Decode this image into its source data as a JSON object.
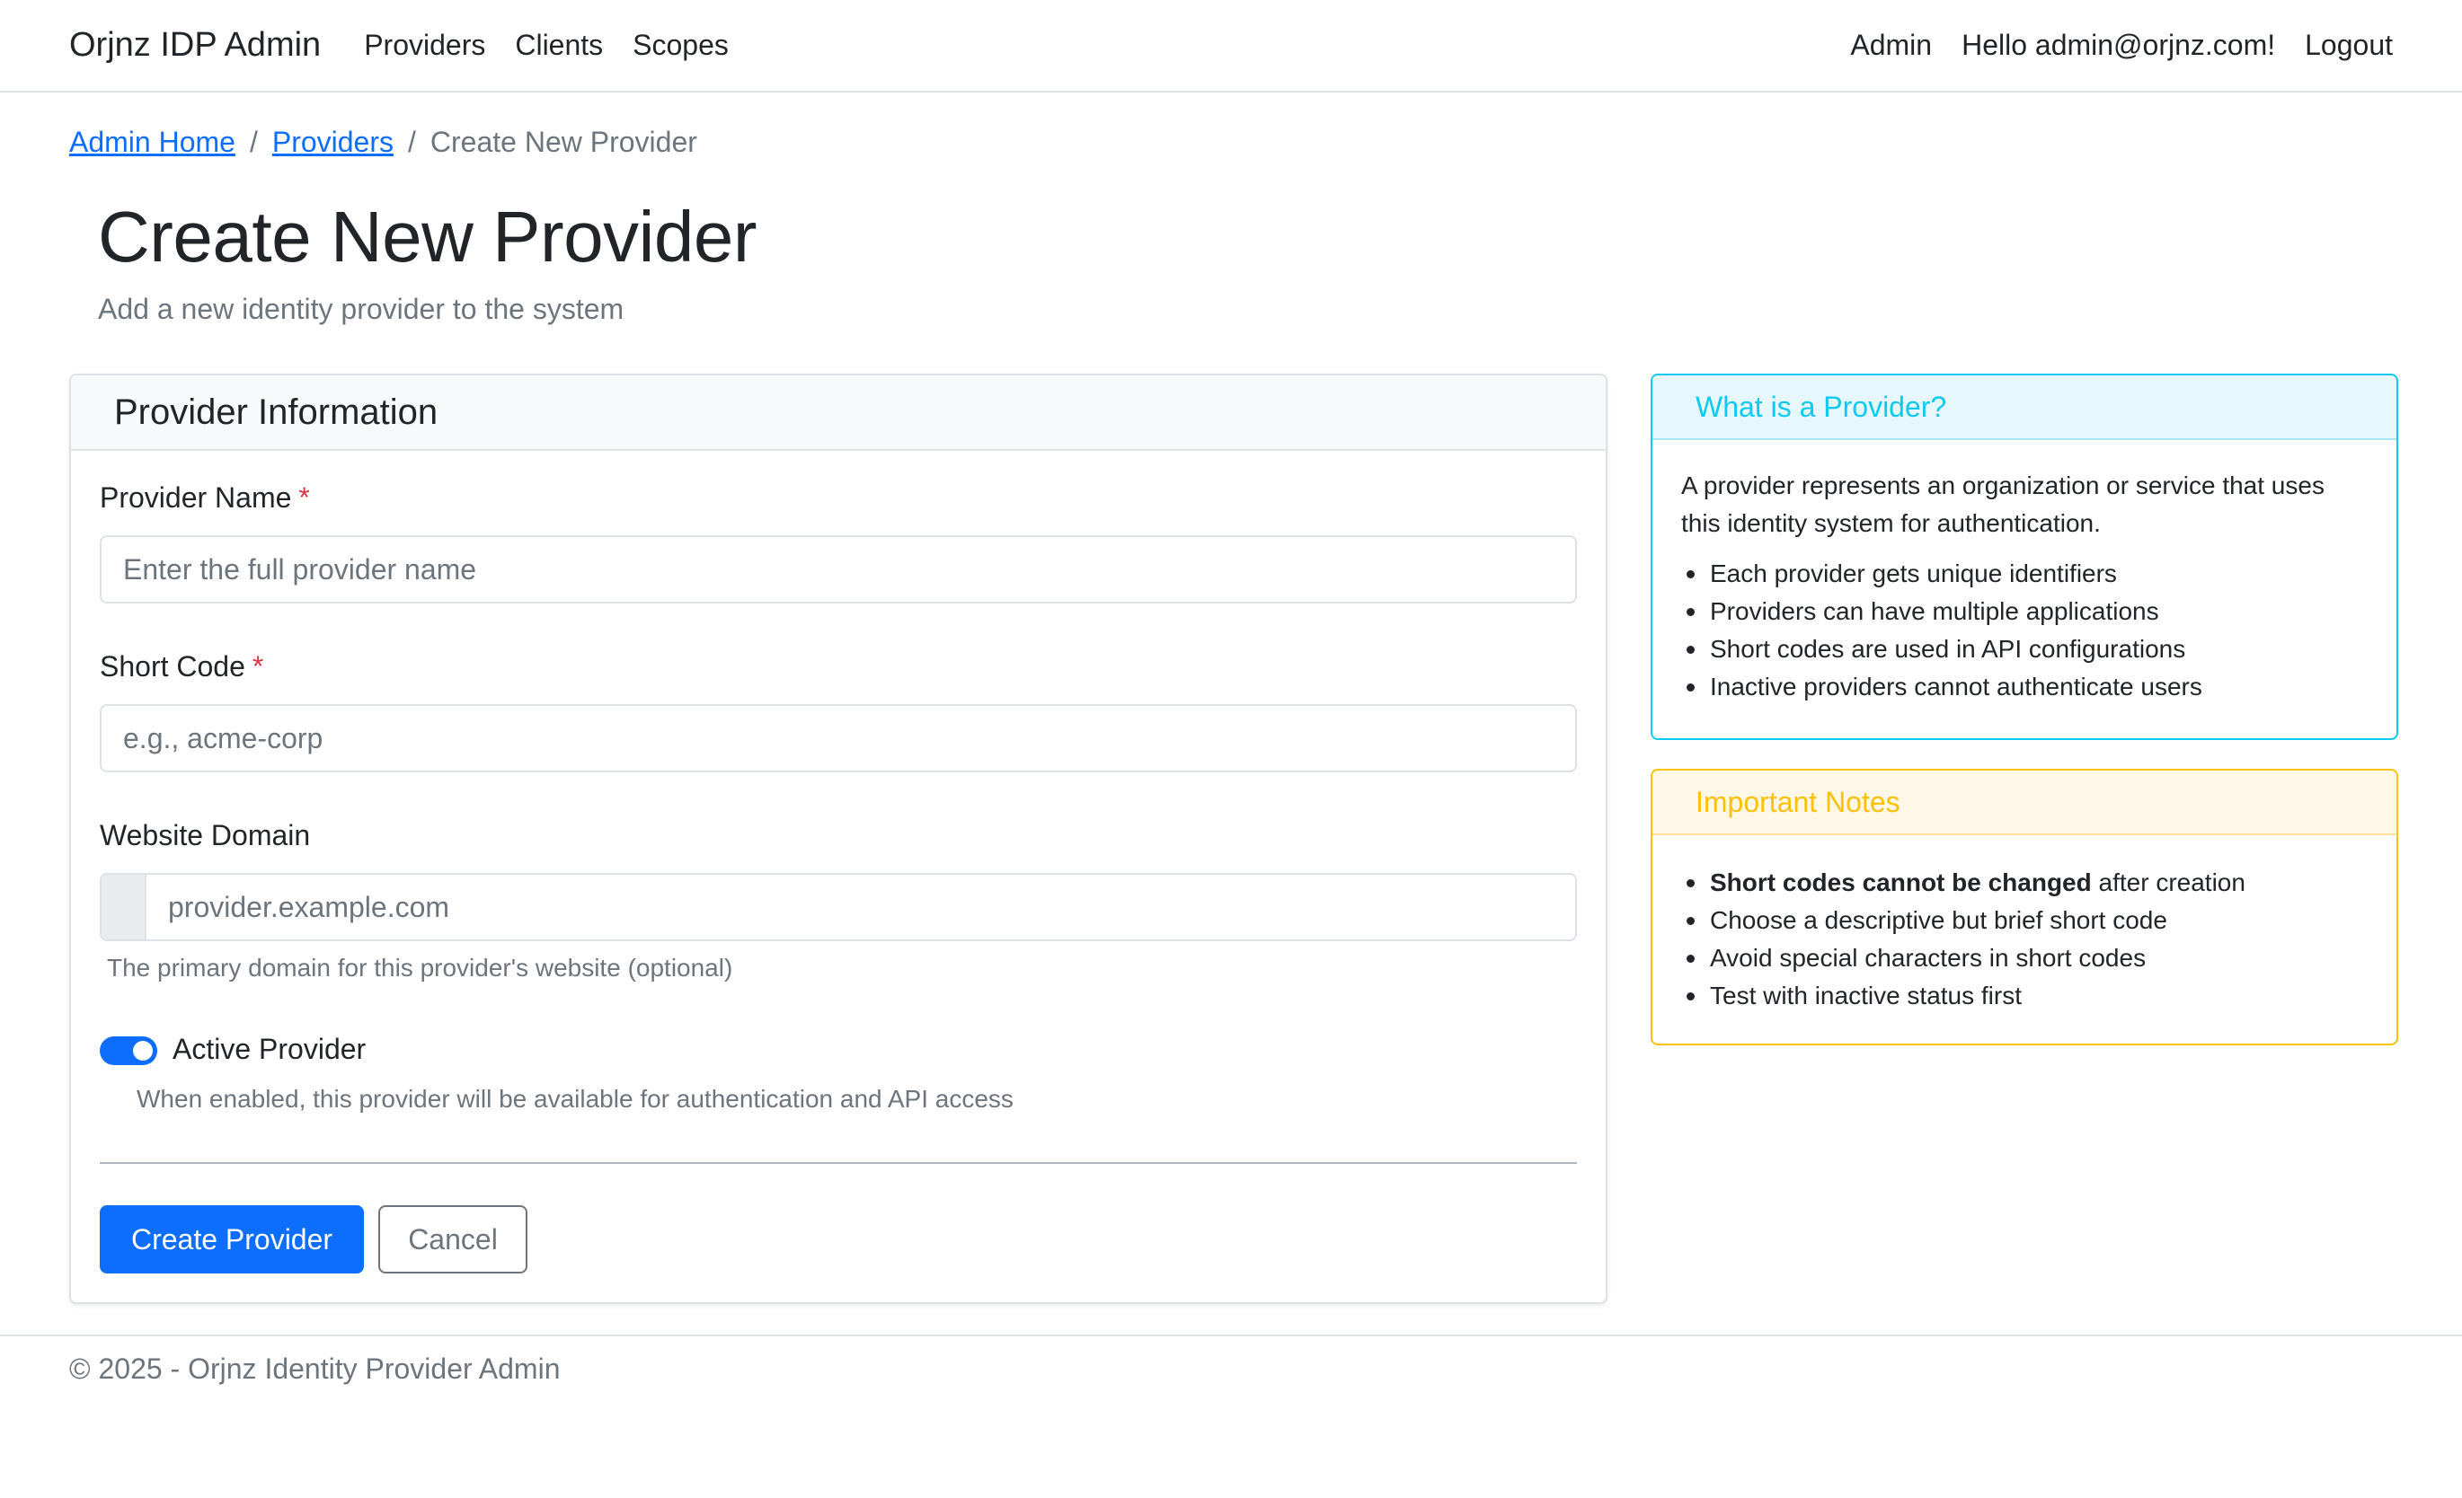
{
  "navbar": {
    "brand": "Orjnz IDP Admin",
    "links": [
      "Providers",
      "Clients",
      "Scopes"
    ],
    "right": {
      "admin": "Admin",
      "greeting": "Hello admin@orjnz.com!",
      "logout": "Logout"
    }
  },
  "breadcrumb": {
    "home": "Admin Home",
    "sep": "/",
    "providers": "Providers",
    "current": "Create New Provider"
  },
  "header": {
    "title": "Create New Provider",
    "subtitle": "Add a new identity provider to the system"
  },
  "form": {
    "card_title": "Provider Information",
    "required_mark": "*",
    "name": {
      "label": "Provider Name",
      "placeholder": "Enter the full provider name",
      "value": ""
    },
    "short_code": {
      "label": "Short Code",
      "placeholder": "e.g., acme-corp",
      "value": ""
    },
    "domain": {
      "label": "Website Domain",
      "placeholder": "provider.example.com",
      "value": "",
      "help": "The primary domain for this provider's website (optional)"
    },
    "active": {
      "label": "Active Provider",
      "checked": true,
      "help": "When enabled, this provider will be available for authentication and API access"
    },
    "submit_label": "Create Provider",
    "cancel_label": "Cancel"
  },
  "info_card": {
    "title": "What is a Provider?",
    "intro": "A provider represents an organization or service that uses this identity system for authentication.",
    "items": [
      "Each provider gets unique identifiers",
      "Providers can have multiple applications",
      "Short codes are used in API configurations",
      "Inactive providers cannot authenticate users"
    ]
  },
  "notes_card": {
    "title": "Important Notes",
    "first_bold": "Short codes cannot be changed",
    "first_rest": " after creation",
    "items": [
      "Choose a descriptive but brief short code",
      "Avoid special characters in short codes",
      "Test with inactive status first"
    ]
  },
  "footer": {
    "text": "© 2025 - Orjnz Identity Provider Admin"
  },
  "colors": {
    "primary": "#0d6efd",
    "info": "#0dcaf0",
    "warning": "#ffc107",
    "danger": "#dc3545",
    "muted": "#6c757d"
  }
}
